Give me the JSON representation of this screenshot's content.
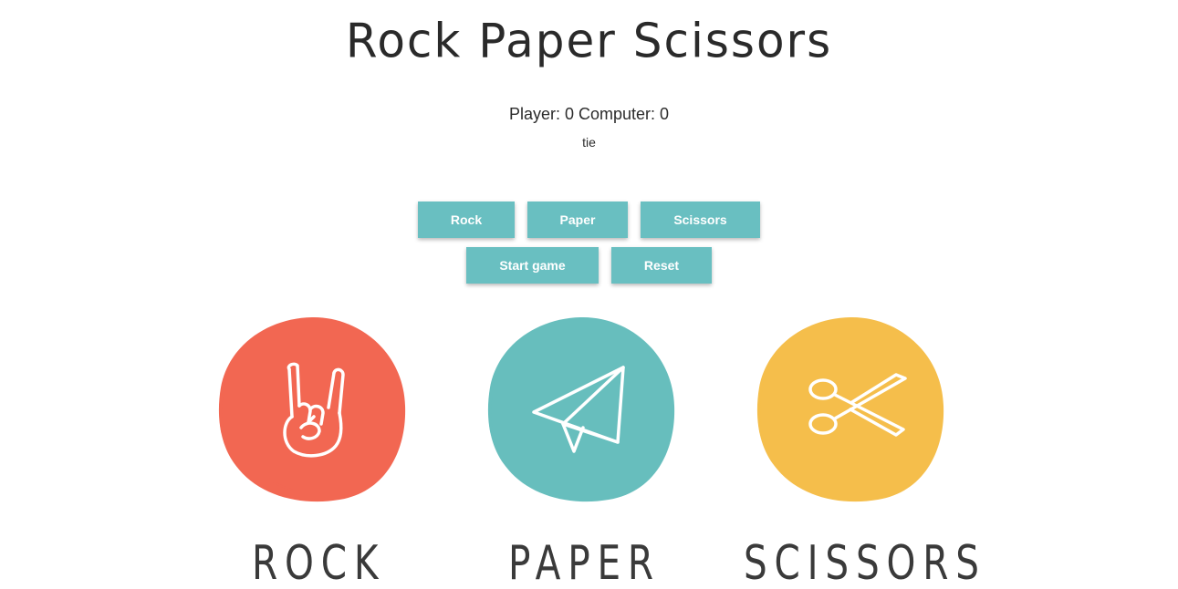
{
  "title": "Rock Paper Scissors",
  "score": {
    "text": "Player: 0 Computer: 0"
  },
  "result": "tie",
  "buttons": {
    "rock": "Rock",
    "paper": "Paper",
    "scissors": "Scissors",
    "start": "Start game",
    "reset": "Reset"
  },
  "choices": [
    {
      "label": "ROCK",
      "icon": "rock-hand-icon",
      "color": "#f26752"
    },
    {
      "label": "PAPER",
      "icon": "paper-plane-icon",
      "color": "#67bebd"
    },
    {
      "label": "SCISSORS",
      "icon": "scissors-icon",
      "color": "#f5be4b"
    }
  ],
  "colors": {
    "button": "#69bfc1",
    "button_text": "#ffffff"
  }
}
